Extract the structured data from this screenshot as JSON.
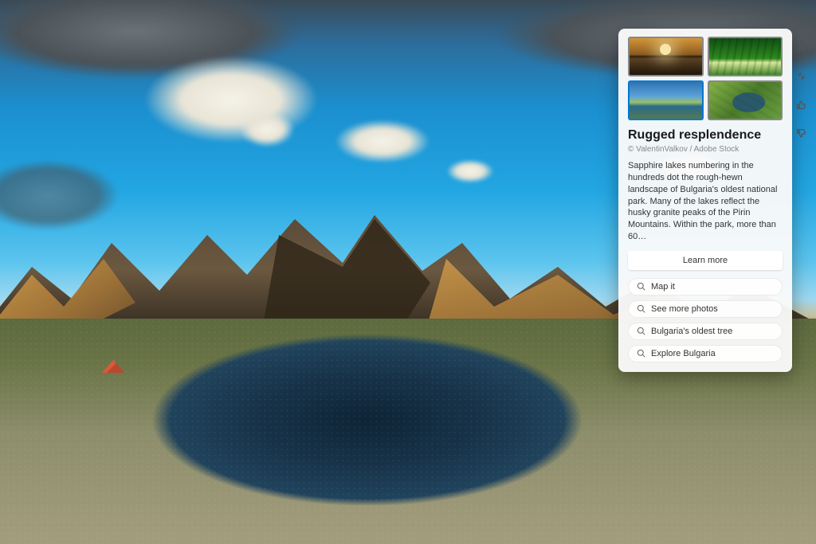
{
  "spotlight": {
    "title": "Rugged resplendence",
    "attribution": "© ValentinValkov / Adobe Stock",
    "description": "Sapphire lakes numbering in the hundreds dot the rough-hewn landscape of Bulgaria's oldest national park. Many of the lakes reflect the husky granite peaks of the Pirin Mountains. Within the park, more than 60…",
    "learn_more_label": "Learn more",
    "thumbnails": [
      {
        "name": "sunset-lake"
      },
      {
        "name": "bamboo-forest"
      },
      {
        "name": "mountain-lake",
        "selected": true
      },
      {
        "name": "aerial-river"
      }
    ],
    "suggestions": [
      {
        "icon": "search-icon",
        "label": "Map it"
      },
      {
        "icon": "search-icon",
        "label": "See more photos"
      },
      {
        "icon": "search-icon",
        "label": "Bulgaria's oldest tree"
      },
      {
        "icon": "search-icon",
        "label": "Explore Bulgaria"
      }
    ]
  },
  "rail": {
    "close": "close-icon",
    "minimize": "minimize-icon",
    "like": "thumbs-up-icon",
    "dislike": "thumbs-down-icon"
  }
}
